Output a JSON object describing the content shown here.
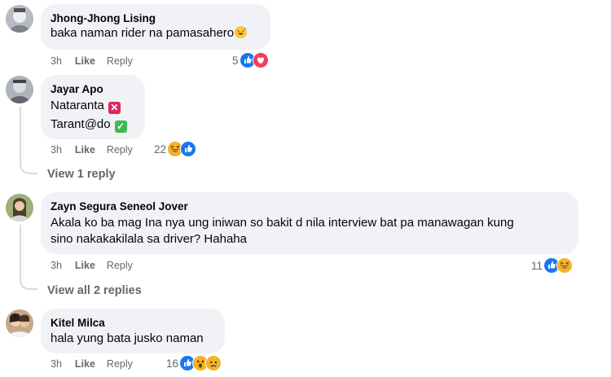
{
  "comments": [
    {
      "author": "Jhong-Jhong Lising",
      "lines": [
        "baka naman rider na pamasahero"
      ],
      "time": "3h",
      "like_label": "Like",
      "reply_label": "Reply",
      "reaction_count": "5",
      "reactions": [
        "like-icon",
        "love-icon"
      ],
      "emoji": "grinning-sweat-emoji"
    },
    {
      "author": "Jayar Apo",
      "lines": [
        "Nataranta",
        "Tarant@do"
      ],
      "badges": [
        "cross-mark-icon",
        "check-mark-icon"
      ],
      "time": "3h",
      "like_label": "Like",
      "reply_label": "Reply",
      "reaction_count": "22",
      "reactions": [
        "haha-icon",
        "like-icon"
      ],
      "view_replies": "View 1 reply"
    },
    {
      "author": "Zayn Segura Seneol Jover",
      "lines": [
        "Akala ko ba mag Ina nya ung iniwan so bakit d nila interview bat pa manawagan kung",
        "sino nakakakilala sa driver? Hahaha"
      ],
      "time": "3h",
      "like_label": "Like",
      "reply_label": "Reply",
      "reaction_count": "11",
      "reactions": [
        "like-icon",
        "haha-icon"
      ],
      "view_replies": "View all 2 replies"
    },
    {
      "author": "Kitel Milca",
      "lines": [
        "hala yung bata jusko naman"
      ],
      "time": "3h",
      "like_label": "Like",
      "reply_label": "Reply",
      "reaction_count": "16",
      "reactions": [
        "like-icon",
        "wow-icon",
        "sad-icon"
      ]
    }
  ],
  "colors": {
    "bubble": "#f0f2f5",
    "meta": "#65676b",
    "like_blue": "#1877f2",
    "love_red": "#f33e58",
    "haha_yellow": "#f7b125",
    "cross_red": "#e0245e",
    "check_green": "#3fb950"
  }
}
